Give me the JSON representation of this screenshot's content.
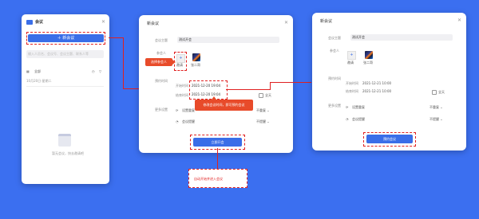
{
  "sidebar": {
    "title": "会议",
    "new_meeting_button": "新会议",
    "search_placeholder": "输入人员名、会议号、会议主题、联系人等",
    "filter_tab": "全部",
    "date_label": "10月20日·星期二",
    "empty_text": "暂无会议，快去邀请吧"
  },
  "dialog1": {
    "title": "新会议",
    "topic_label": "会议主题",
    "topic_value": "测试开会",
    "participants_label": "参会人",
    "add_label": "邀请",
    "participant_name": "张二哥",
    "time_label": "预约时间",
    "start_label": "开始时间",
    "start_value": "2021-12-20 19:04",
    "end_label": "结束时间",
    "end_value": "2021-12-20 19:04",
    "allday_label": "全天",
    "more_label": "更多设置",
    "repeat_label": "设置重复",
    "repeat_value": "不重复",
    "remind_label": "会议提醒",
    "remind_value": "不提醒",
    "start_button": "立即开会"
  },
  "dialog2": {
    "title": "新会议",
    "topic_label": "会议主题",
    "topic_value": "测试开会",
    "participants_label": "参会人",
    "add_label": "邀请",
    "participant_name": "张二哥",
    "time_label": "预约时间",
    "start_label": "开始时间",
    "start_value": "2021-12-21 10:00",
    "end_label": "结束时间",
    "end_value": "2021-12-21 10:00",
    "allday_label": "全天",
    "more_label": "更多设置",
    "repeat_label": "设置重复",
    "repeat_value": "不重复",
    "remind_label": "会议提醒",
    "remind_value": "不提醒",
    "book_button": "预约会议"
  },
  "callouts": {
    "select_participants": "选择参会人",
    "modify_time": "修改会议时间，即可预约会议",
    "auto_start": "自动开始并进入会议"
  },
  "colors": {
    "background": "#3b6ff0",
    "accent": "#3a6ee8",
    "callout": "#e84b2a"
  }
}
